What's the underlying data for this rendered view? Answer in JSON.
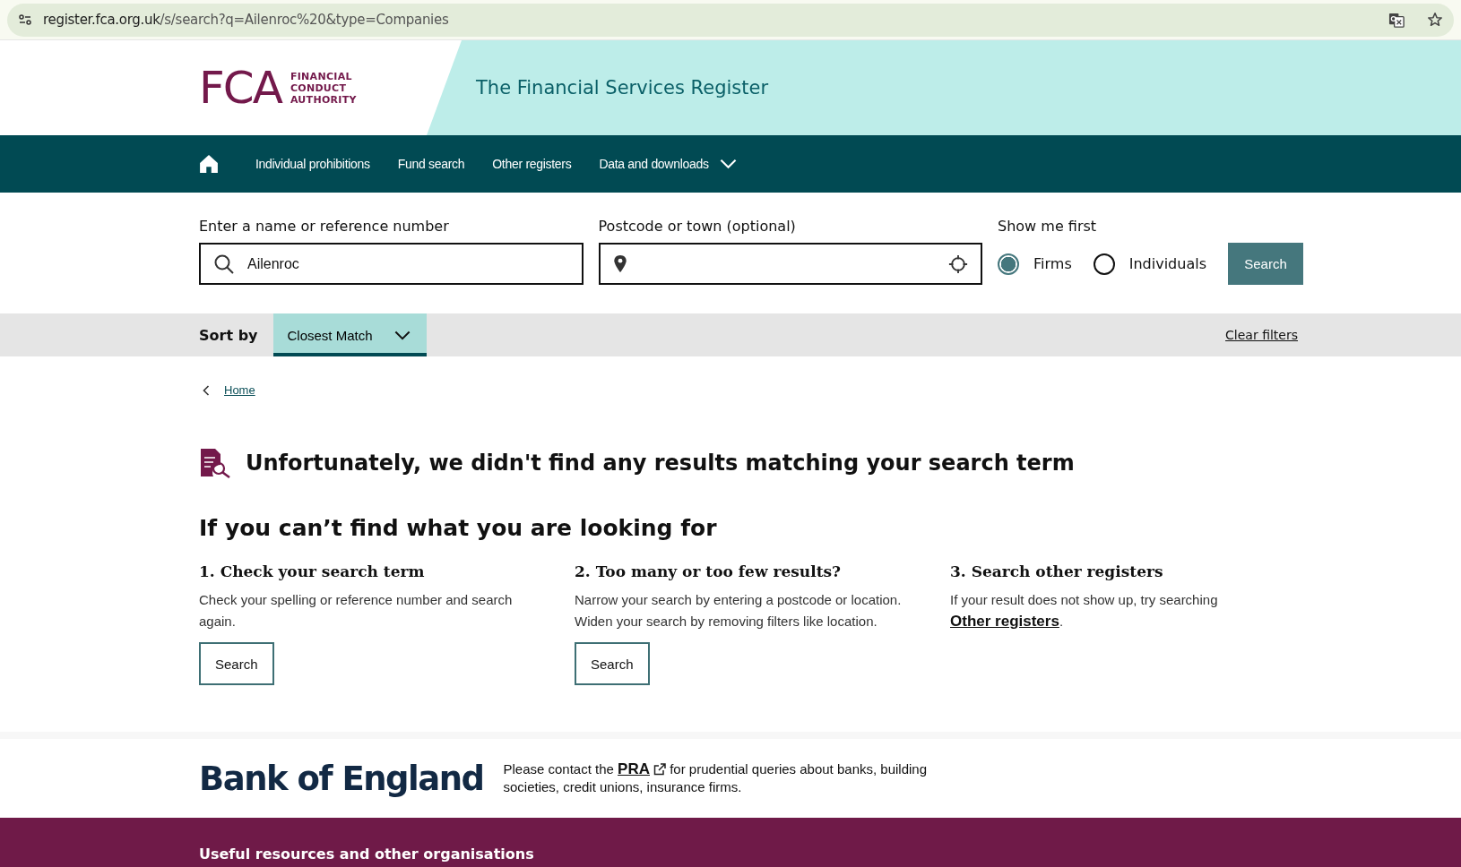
{
  "browser": {
    "url_host": "register.fca.org.uk",
    "url_path": "/s/search?q=Ailenroc%20&type=Companies"
  },
  "header": {
    "logo_letters": "FCA",
    "logo_words": [
      "FINANCIAL",
      "CONDUCT",
      "AUTHORITY"
    ],
    "title": "The Financial Services Register"
  },
  "nav": {
    "items": [
      {
        "kind": "home"
      },
      {
        "kind": "link",
        "label": "Individual prohibitions"
      },
      {
        "kind": "link",
        "label": "Fund search"
      },
      {
        "kind": "link",
        "label": "Other registers"
      },
      {
        "kind": "dropdown",
        "label": "Data and downloads"
      }
    ]
  },
  "search": {
    "name_label": "Enter a name or reference number",
    "name_value": "Ailenroc",
    "location_label": "Postcode or town (optional)",
    "show_label": "Show me first",
    "options": [
      {
        "label": "Firms",
        "selected": true
      },
      {
        "label": "Individuals",
        "selected": false
      }
    ],
    "button": "Search"
  },
  "sort": {
    "label": "Sort by",
    "value": "Closest Match",
    "clear": "Clear filters"
  },
  "breadcrumb": "Home",
  "no_results": "Unfortunately, we didn't find any results matching your search term",
  "help": {
    "title": "If you can’t find what you are looking for",
    "columns": [
      {
        "heading": "1. Check your search term",
        "text": "Check your spelling or reference number and search again.",
        "button": "Search"
      },
      {
        "heading": "2. Too many or too few results?",
        "text": "Narrow your search by entering a postcode or location. Widen your search by removing filters like location.",
        "button": "Search"
      },
      {
        "heading": "3. Search other registers",
        "text": "If your result does not show up, try searching ",
        "link": "Other registers",
        "after": "."
      }
    ]
  },
  "boe": {
    "logo": "Bank of England",
    "before": "Please contact the ",
    "link": "PRA",
    "after": " for prudential queries about banks, building societies, credit unions, insurance firms."
  },
  "footer": {
    "title": "Useful resources and other organisations"
  }
}
